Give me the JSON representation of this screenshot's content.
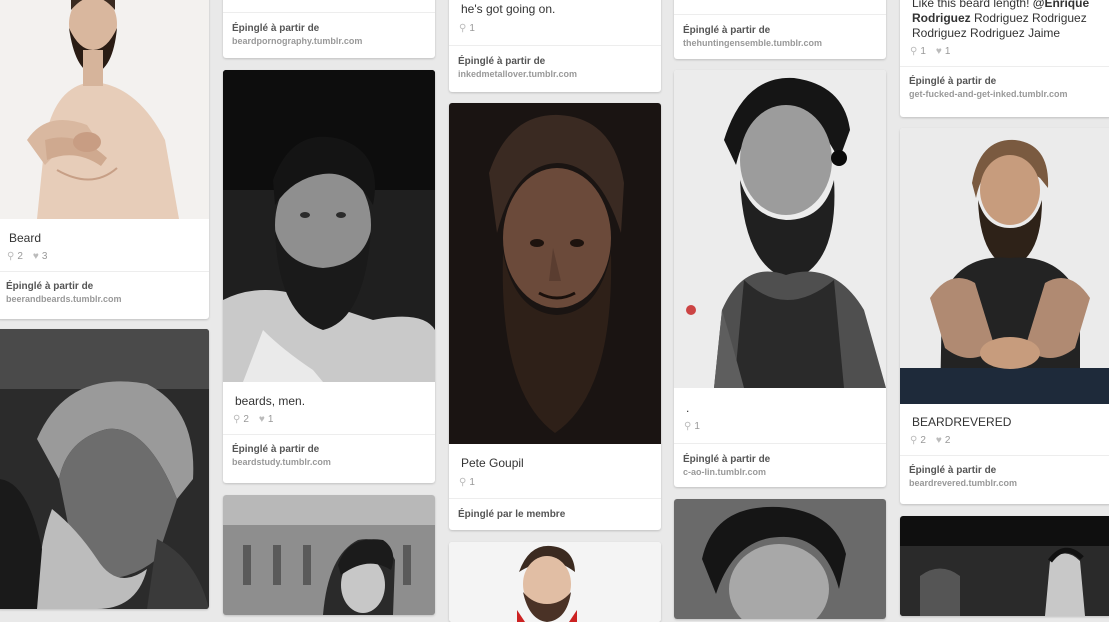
{
  "pinned_from_label": "Épinglé à partir de",
  "pinned_by_member_label": "Épinglé par le membre",
  "col1": {
    "card1": {
      "desc": "Beard",
      "repins": "2",
      "likes": "3",
      "source": "beerandbeards.tumblr.com"
    }
  },
  "col2": {
    "card1": {
      "source": "beardpornography.tumblr.com"
    },
    "card2": {
      "desc": "beards, men.",
      "repins": "2",
      "likes": "1",
      "source": "beardstudy.tumblr.com"
    }
  },
  "col3": {
    "card1": {
      "desc": "he's got going on.",
      "repins": "1",
      "source": "inkedmetallover.tumblr.com"
    },
    "card2": {
      "desc": "Pete Goupil",
      "repins": "1"
    }
  },
  "col4": {
    "card1": {
      "source": "thehuntingensemble.tumblr.com"
    },
    "card2": {
      "desc": ".",
      "repins": "1",
      "source": "c-ao-lin.tumblr.com"
    }
  },
  "col5": {
    "card1": {
      "desc_line1": "Like this beard length! ",
      "desc_mention1": "@Enrique",
      "desc_mention2": "Rodriguez",
      "desc_rest": " Rodriguez Rodriguez Rodriguez Rodriguez Jaime",
      "repins": "1",
      "likes": "1",
      "source": "get-fucked-and-get-inked.tumblr.com"
    },
    "card2": {
      "desc": "BEARDREVERED",
      "repins": "2",
      "likes": "2",
      "source": "beardrevered.tumblr.com"
    }
  },
  "colors": {
    "background": "#e9e9e9",
    "card": "#ffffff",
    "text": "#333333",
    "muted": "#999999"
  }
}
